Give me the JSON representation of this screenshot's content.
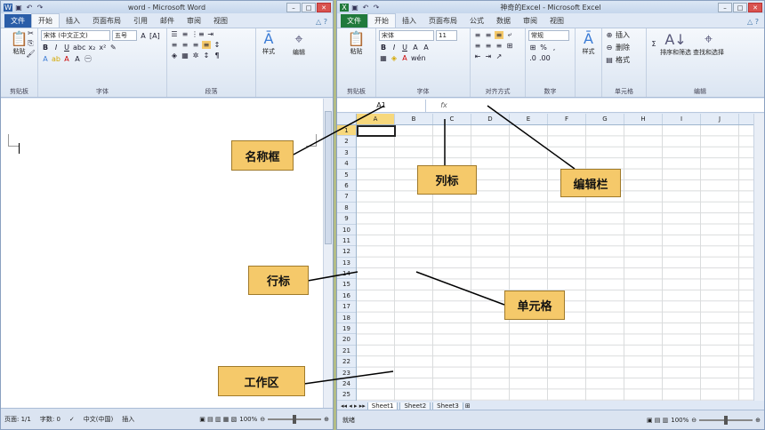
{
  "word": {
    "title": "word - Microsoft Word",
    "tabs": [
      "文件",
      "开始",
      "插入",
      "页面布局",
      "引用",
      "邮件",
      "审阅",
      "视图"
    ],
    "font": "宋体 (中文正文)",
    "size": "五号",
    "groups": [
      "剪贴板",
      "字体",
      "段落"
    ],
    "paste": "粘贴",
    "style": "样式",
    "edit": "编辑",
    "status": {
      "page": "页面: 1/1",
      "words": "字数: 0",
      "lang": "中文(中国)",
      "mode": "插入",
      "zoom": "100%"
    }
  },
  "excel": {
    "title": "神奇的Excel - Microsoft Excel",
    "tabs": [
      "文件",
      "开始",
      "插入",
      "页面布局",
      "公式",
      "数据",
      "审阅",
      "视图"
    ],
    "font": "宋体",
    "size": "11",
    "numfmt": "常规",
    "groups": [
      "剪贴板",
      "字体",
      "对齐方式",
      "数字",
      "单元格",
      "编辑"
    ],
    "paste": "粘贴",
    "style": "样式",
    "insert": "插入",
    "delete": "删除",
    "format": "格式",
    "sort": "排序和筛选",
    "find": "查找和选择",
    "namebox": "A1",
    "fx": "fx",
    "columns": [
      "A",
      "B",
      "C",
      "D",
      "E",
      "F",
      "G",
      "H",
      "I",
      "J"
    ],
    "rows": [
      "1",
      "2",
      "3",
      "4",
      "5",
      "6",
      "7",
      "8",
      "9",
      "10",
      "11",
      "12",
      "13",
      "14",
      "15",
      "16",
      "17",
      "18",
      "19",
      "20",
      "21",
      "22",
      "23",
      "24",
      "25"
    ],
    "sheets": [
      "Sheet1",
      "Sheet2",
      "Sheet3"
    ],
    "status": {
      "ready": "就绪",
      "zoom": "100%"
    }
  },
  "callouts": {
    "namebox": "名称框",
    "column": "列标",
    "formula": "编辑栏",
    "row": "行标",
    "cell": "单元格",
    "workarea": "工作区"
  }
}
